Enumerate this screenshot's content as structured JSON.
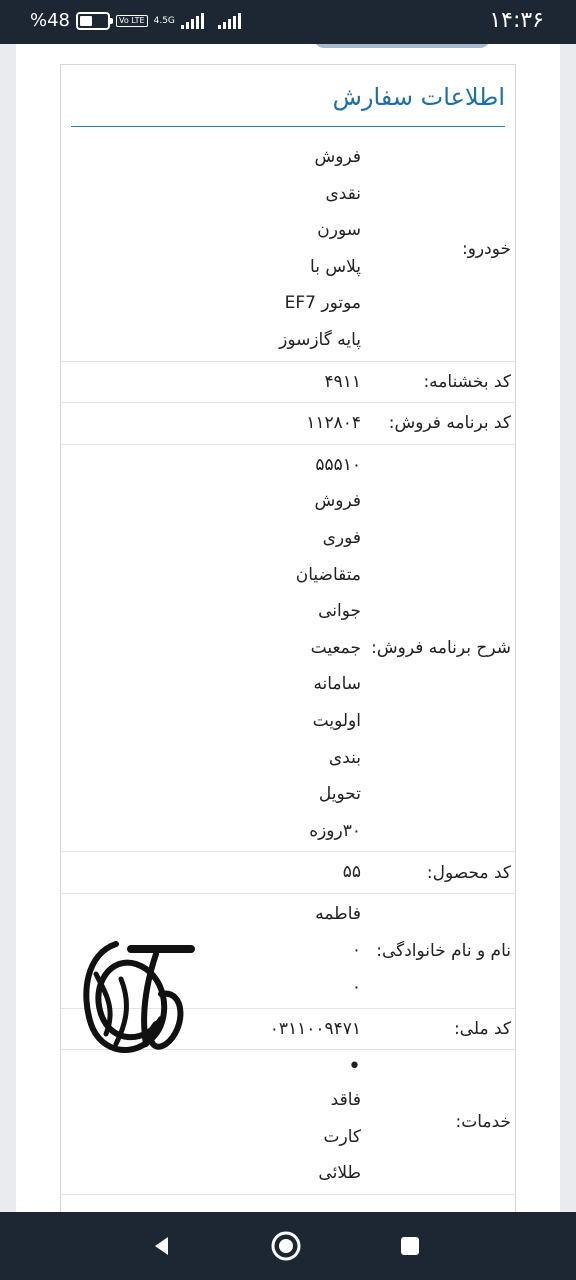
{
  "status_bar": {
    "time": "۱۴:۳۶",
    "battery_text": "%48",
    "battery_level": 0.48,
    "volte": "Vo LTE",
    "network": "4.5G"
  },
  "order": {
    "title": "اطلاعات سفارش",
    "rows": [
      {
        "label": "خودرو:",
        "lines": [
          "فروش",
          "نقدی",
          "سورن",
          "پلاس با",
          "موتور EF7",
          "پایه گازسوز"
        ]
      },
      {
        "label": "کد بخشنامه:",
        "lines": [
          "۴۹۱۱"
        ]
      },
      {
        "label": "کد برنامه فروش:",
        "lines": [
          "۱۱۲۸۰۴"
        ]
      },
      {
        "label": "شرح برنامه فروش:",
        "lines": [
          "۵۵۵۱۰",
          "فروش",
          "فوری",
          "متقاضیان",
          "جوانی",
          "جمعیت",
          "سامانه",
          "اولویت",
          "بندی",
          "تحویل",
          "۳۰روزه"
        ]
      },
      {
        "label": "کد محصول:",
        "lines": [
          "۵۵"
        ]
      },
      {
        "label": "نام و نام خانوادگی:",
        "lines": [
          "فاطمه",
          "۰",
          "۰"
        ]
      },
      {
        "label": "کد ملی:",
        "lines": [
          "۰۳۱۱۰۰۹۴۷۱"
        ]
      },
      {
        "label": "خدمات:",
        "bullet": "•",
        "lines": [
          "فاقد",
          "کارت",
          "طلائی"
        ]
      }
    ]
  },
  "navbar": {
    "back_icon": "back-triangle-icon",
    "home_icon": "home-circle-icon",
    "recents_icon": "recents-square-icon"
  }
}
